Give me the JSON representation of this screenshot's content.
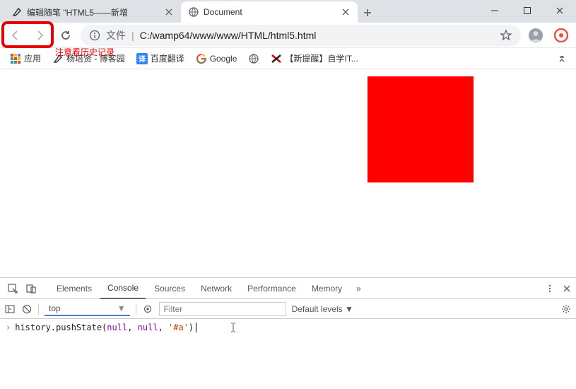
{
  "window": {
    "tab1_title": "编辑随笔 \"HTML5——新增",
    "tab2_title": "Document",
    "min": "—",
    "max": "☐",
    "close": "✕"
  },
  "toolbar": {
    "url_prefix": "文件",
    "url_sep": "|",
    "url_path": "C:/wamp64/www/www/HTML/html5.html",
    "annotation": "注意看历史记录"
  },
  "bookmarks": {
    "apps": "应用",
    "b1": "杨培贤 - 博客园",
    "b2": "百度翻译",
    "b3": "Google",
    "b4": "【新提醒】自学IT..."
  },
  "devtools": {
    "tabs": {
      "elements": "Elements",
      "console": "Console",
      "sources": "Sources",
      "network": "Network",
      "performance": "Performance",
      "memory": "Memory"
    },
    "filter_placeholder": "Filter",
    "context": "top",
    "levels": "Default levels ▼",
    "console_line": {
      "fn": "history.pushState",
      "open": "(",
      "null1": "null",
      "comma": ", ",
      "null2": "null",
      "str": "'#a'",
      "close": ")"
    }
  }
}
